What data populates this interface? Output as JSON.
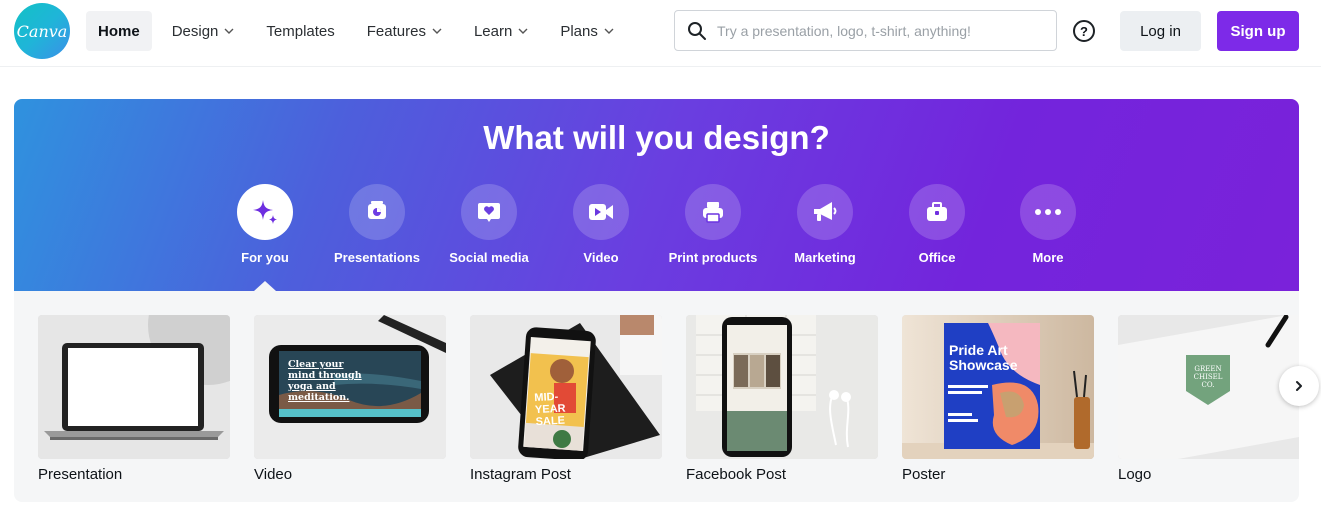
{
  "header": {
    "logo_text": "Canva",
    "nav": [
      {
        "label": "Home",
        "dropdown": false,
        "active": true
      },
      {
        "label": "Design",
        "dropdown": true
      },
      {
        "label": "Templates",
        "dropdown": false
      },
      {
        "label": "Features",
        "dropdown": true
      },
      {
        "label": "Learn",
        "dropdown": true
      },
      {
        "label": "Plans",
        "dropdown": true
      }
    ],
    "search_placeholder": "Try a presentation, logo, t-shirt, anything!",
    "help_icon": "question-circle-icon",
    "login_label": "Log in",
    "signup_label": "Sign up",
    "accent_color": "#7d2ae8"
  },
  "hero": {
    "title": "What will you design?",
    "categories": [
      {
        "label": "For you",
        "icon": "sparkle-icon",
        "active": true
      },
      {
        "label": "Presentations",
        "icon": "presentation-icon"
      },
      {
        "label": "Social media",
        "icon": "heart-chat-icon"
      },
      {
        "label": "Video",
        "icon": "video-camera-icon"
      },
      {
        "label": "Print products",
        "icon": "printer-icon"
      },
      {
        "label": "Marketing",
        "icon": "megaphone-icon"
      },
      {
        "label": "Office",
        "icon": "briefcase-icon"
      },
      {
        "label": "More",
        "icon": "more-dots-icon"
      }
    ]
  },
  "cards": [
    {
      "label": "Presentation"
    },
    {
      "label": "Video",
      "thumb_text": "Clear your mind through yoga and meditation."
    },
    {
      "label": "Instagram Post",
      "thumb_text": "MID-YEAR SALE"
    },
    {
      "label": "Facebook Post"
    },
    {
      "label": "Poster",
      "thumb_text": "Pride Art Showcase"
    },
    {
      "label": "Logo",
      "thumb_text": "GREEN CHISEL CO."
    }
  ]
}
